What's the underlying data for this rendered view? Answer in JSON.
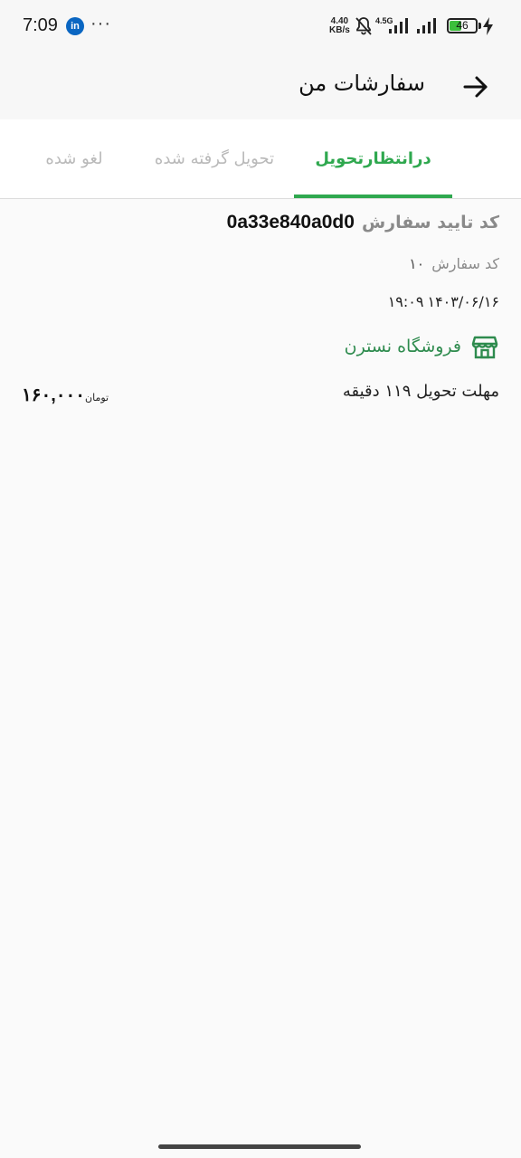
{
  "status_bar": {
    "time": "7:09",
    "app_badge": "in",
    "more": "···",
    "net_speed_value": "4.40",
    "net_speed_unit": "KB/s",
    "network_type": "4.5G",
    "battery": "46"
  },
  "header": {
    "title": "سفارشات من",
    "back_icon": "arrow-right-icon"
  },
  "tabs": [
    {
      "label": "درانتظارتحویل",
      "active": true
    },
    {
      "label": "تحویل گرفته شده",
      "active": false
    },
    {
      "label": "لغو شده",
      "active": false
    }
  ],
  "order": {
    "confirm_label": "کد تایید سفارش",
    "confirm_code": "0a33e840a0d0",
    "order_label": "کد سفارش",
    "order_number": "۱۰",
    "date": "۱۴۰۳/۰۶/۱۶",
    "time": "۱۹:۰۹",
    "store_icon": "store-icon",
    "store_name": "فروشگاه نسترن",
    "deadline": "مهلت تحویل ۱۱۹ دقیقه",
    "price": "۱۶۰,۰۰۰",
    "currency": "تومان"
  },
  "colors": {
    "accent": "#2fa84f",
    "store_green": "#2e8b4e",
    "muted_text": "#8a8a8a"
  }
}
